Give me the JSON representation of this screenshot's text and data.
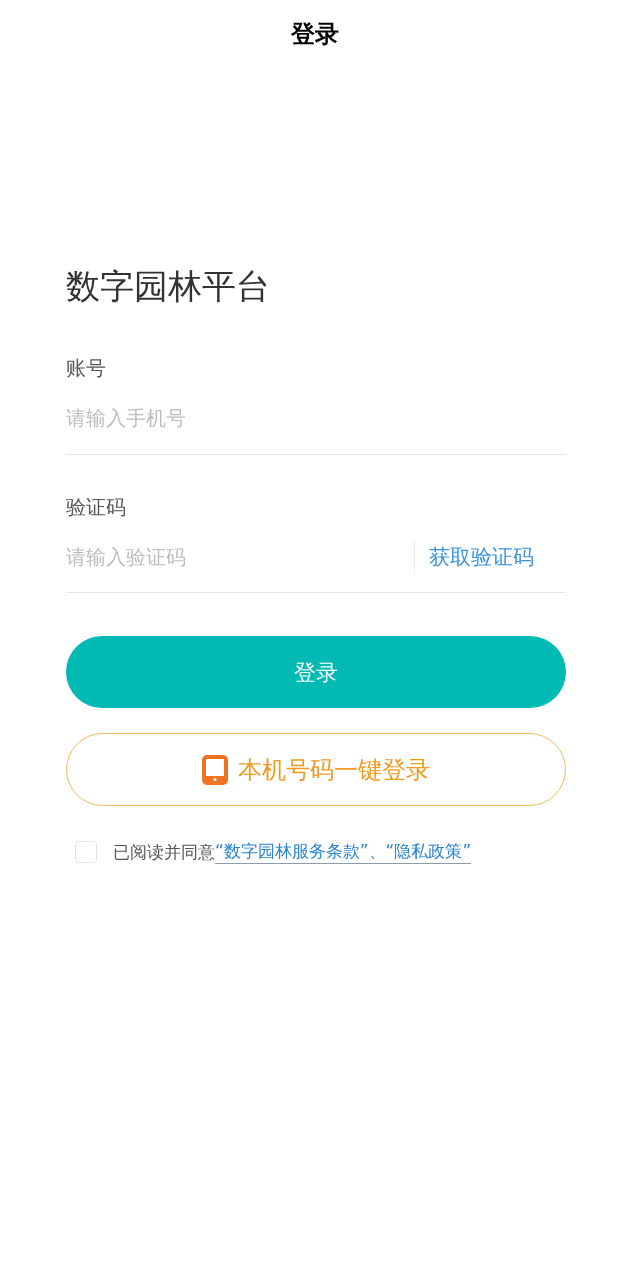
{
  "header": {
    "title": "登录"
  },
  "app_title": "数字园林平台",
  "fields": [
    {
      "kind": "text",
      "label": "账号",
      "placeholder": "请输入手机号"
    },
    {
      "kind": "code",
      "label": "验证码",
      "placeholder": "请输入验证码",
      "action": "获取验证码"
    }
  ],
  "login_button": "登录",
  "quick_login_button": "本机号码一键登录",
  "agreement": {
    "checked": false,
    "text": "已阅读并同意",
    "link": "“数字园林服务条款”、“隐私政策”"
  }
}
